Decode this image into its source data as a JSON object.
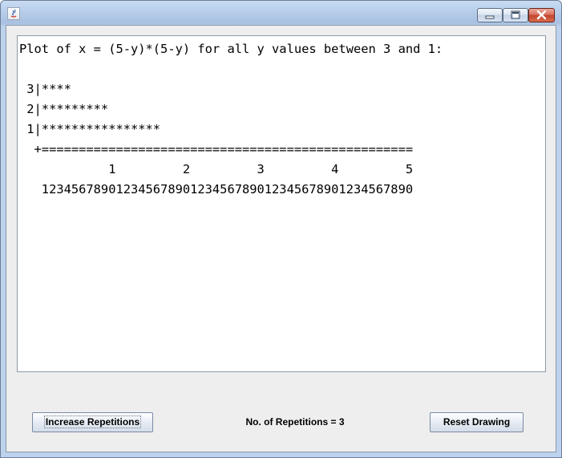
{
  "window": {
    "title": "",
    "controls": {
      "minimize_icon": "minimize-icon",
      "maximize_icon": "maximize-icon",
      "close_icon": "close-icon"
    }
  },
  "plot": {
    "lines": [
      "Plot of x = (5-y)*(5-y) for all y values between 3 and 1:",
      "",
      " 3|****",
      " 2|*********",
      " 1|****************",
      "  +==================================================",
      "            1         2         3         4         5",
      "   12345678901234567890123456789012345678901234567890"
    ]
  },
  "controls": {
    "increase_label": "Increase Repetitions",
    "status_text": "No. of Repetitions = 3",
    "reset_label": "Reset Drawing"
  }
}
